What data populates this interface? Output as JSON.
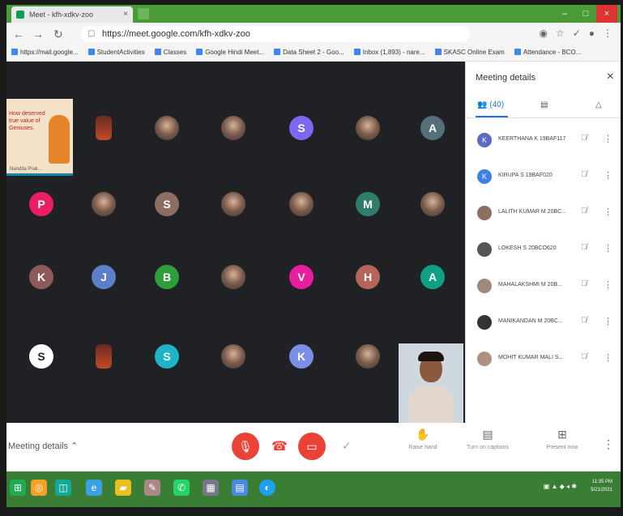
{
  "browser": {
    "tab_title": "Meet - kfh-xdkv-zoo",
    "url": "https://meet.google.com/kfh-xdkv-zoo",
    "bookmarks": [
      "https://mail.google...",
      "StudentActivities",
      "Classes",
      "Google Hindi Meet...",
      "Data Sheet 2 - Goo...",
      "Inbox (1,893) - nare...",
      "SKASC Online Exam",
      "Attendance - BCO..."
    ]
  },
  "grid": {
    "presenter_text": "How deserved true value of Geniuses.",
    "presenter_name": "Nandita Prak..."
  },
  "tiles": [
    {
      "type": "presentation"
    },
    {
      "type": "cam"
    },
    {
      "type": "photo"
    },
    {
      "type": "photo"
    },
    {
      "type": "avatar",
      "letter": "S",
      "color": "#7b68ee"
    },
    {
      "type": "photo"
    },
    {
      "type": "avatar",
      "letter": "A",
      "color": "#546e7a"
    },
    {
      "type": "avatar",
      "letter": "P",
      "color": "#e91e63"
    },
    {
      "type": "photo"
    },
    {
      "type": "avatar",
      "letter": "S",
      "color": "#8d6e63"
    },
    {
      "type": "photo"
    },
    {
      "type": "photo"
    },
    {
      "type": "avatar",
      "letter": "M",
      "color": "#2e7d6b"
    },
    {
      "type": "photo"
    },
    {
      "type": "avatar",
      "letter": "K",
      "color": "#8d5a5a"
    },
    {
      "type": "avatar",
      "letter": "J",
      "color": "#5c7fc9"
    },
    {
      "type": "avatar",
      "letter": "B",
      "color": "#2e9e3a"
    },
    {
      "type": "photo"
    },
    {
      "type": "avatar",
      "letter": "V",
      "color": "#e91e9e"
    },
    {
      "type": "avatar",
      "letter": "H",
      "color": "#b5655a"
    },
    {
      "type": "avatar",
      "letter": "A",
      "color": "#12a085"
    },
    {
      "type": "avatar",
      "letter": "S",
      "color": "#ffffff",
      "fg": "#222"
    },
    {
      "type": "cam"
    },
    {
      "type": "avatar",
      "letter": "S",
      "color": "#1fb5c9"
    },
    {
      "type": "photo"
    },
    {
      "type": "avatar",
      "letter": "K",
      "color": "#7b8fe6"
    },
    {
      "type": "photo"
    }
  ],
  "panel": {
    "title": "Meeting details",
    "close_icon": "×",
    "people_count": "(40)",
    "participants": [
      {
        "name": "KEERTHANA K 19BAF117",
        "initial": "K",
        "color": "#5c6bc0"
      },
      {
        "name": "KIRUPA S 19BAF020",
        "initial": "K",
        "color": "#3f7fe6"
      },
      {
        "name": "LALITH KUMAR M 20BC...",
        "initial": "",
        "color": "#8d6e63"
      },
      {
        "name": "LOKESH S 20BCO620",
        "initial": "",
        "color": "#555555"
      },
      {
        "name": "MAHALAKSHMI M 20B...",
        "initial": "",
        "color": "#a0887a"
      },
      {
        "name": "MANIKANDAN M 20BC...",
        "initial": "",
        "color": "#333333"
      },
      {
        "name": "MOHIT KUMAR MALI S...",
        "initial": "",
        "color": "#b09080"
      }
    ]
  },
  "bottombar": {
    "meeting_details": "Meeting details",
    "raise_hand": "Raise hand",
    "captions": "Turn on captions",
    "present": "Present now"
  },
  "taskbar": {
    "time": "11:35 PM",
    "date": "5/21/2021"
  }
}
